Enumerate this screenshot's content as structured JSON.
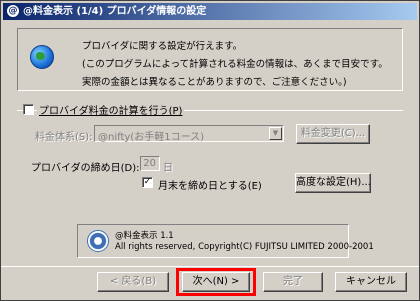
{
  "window": {
    "title": "@料金表示 (1/4) プロバイダ情報の設定",
    "title_icon": "@"
  },
  "info": {
    "line1": "プロバイダに関する設定が行えます。",
    "line2": "(このプログラムによって計算される料金の情報は、あくまで目安です。",
    "line3": "実際の金額とは異なることがありますので、ご注意ください。)"
  },
  "fee_calc": {
    "checkbox_label": "プロバイダ料金の計算を行う(P)",
    "checked": false,
    "plan_label": "料金体系(S):",
    "plan_value": "@nifty(お手軽1コース)",
    "change_button": "料金変更(C)..."
  },
  "closing": {
    "label": "プロバイダの締め日(D):",
    "day_value": "20",
    "day_unit": "日",
    "month_end_label": "月末を締め日とする(E)",
    "month_end_checked": true,
    "advanced_button": "高度な設定(H)..."
  },
  "about": {
    "line1": "@料金表示 1.1",
    "line2": "All rights reserved, Copyright(C) FUJITSU LIMITED 2000-2001"
  },
  "buttons": {
    "back": "< 戻る(B)",
    "next": "次へ(N) >",
    "finish": "完了",
    "cancel": "キャンセル"
  },
  "colors": {
    "highlight": "#ff0000",
    "titlebar_start": "#0a246a",
    "titlebar_end": "#a6caf0"
  }
}
